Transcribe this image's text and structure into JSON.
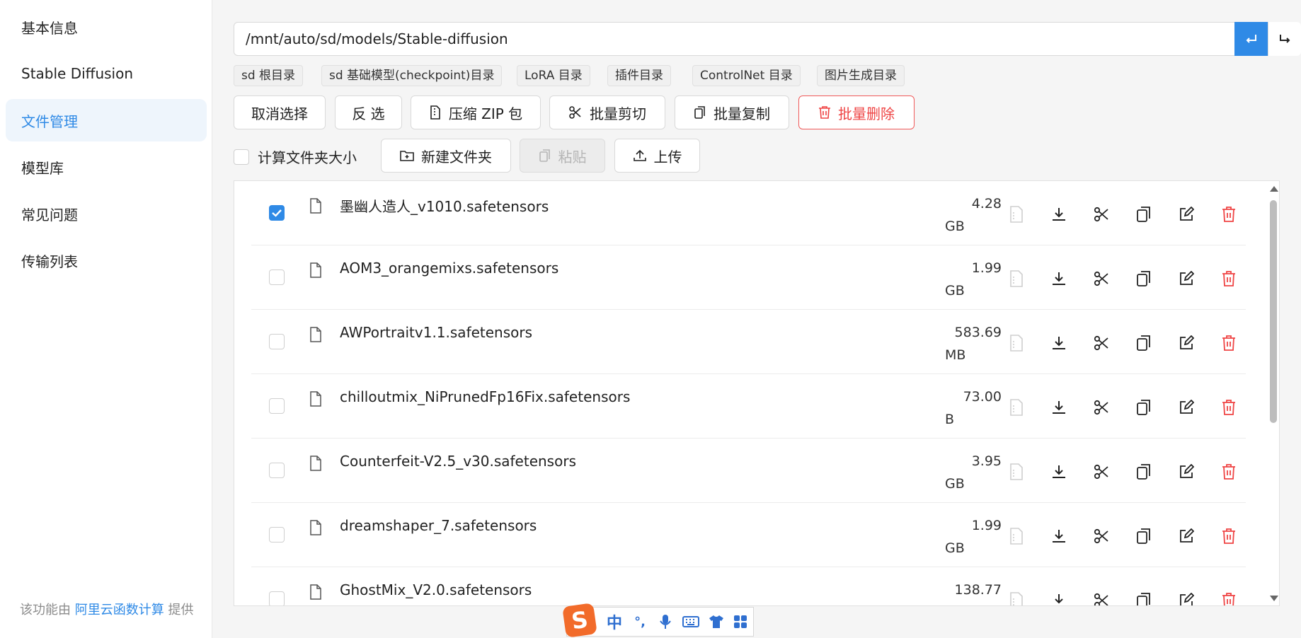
{
  "sidebar": {
    "items": [
      {
        "label": "基本信息",
        "active": false
      },
      {
        "label": "Stable Diffusion",
        "active": false
      },
      {
        "label": "文件管理",
        "active": true
      },
      {
        "label": "模型库",
        "active": false
      },
      {
        "label": "常见问题",
        "active": false
      },
      {
        "label": "传输列表",
        "active": false
      }
    ],
    "footer": {
      "prefix": "该功能由 ",
      "link": "阿里云函数计算",
      "suffix": " 提供"
    }
  },
  "path_bar": {
    "value": "/mnt/auto/sd/models/Stable-diffusion",
    "enter_icon": "enter-icon",
    "back_icon": "return-icon"
  },
  "shortcuts": [
    "sd 根目录",
    "sd 基础模型(checkpoint)目录",
    "LoRA 目录",
    "插件目录",
    "ControlNet 目录",
    "图片生成目录"
  ],
  "toolbar": {
    "deselect": "取消选择",
    "invert": "反 选",
    "zip": "压缩 ZIP 包",
    "batch_cut": "批量剪切",
    "batch_copy": "批量复制",
    "batch_delete": "批量删除",
    "calc_folder_size": "计算文件夹大小",
    "new_folder": "新建文件夹",
    "paste": "粘贴",
    "upload": "上传"
  },
  "files": [
    {
      "name": "墨幽人造人_v1010.safetensors",
      "size": "4.28",
      "unit": "GB",
      "checked": true
    },
    {
      "name": "AOM3_orangemixs.safetensors",
      "size": "1.99",
      "unit": "GB",
      "checked": false
    },
    {
      "name": "AWPortraitv1.1.safetensors",
      "size": "583.69",
      "unit": "MB",
      "checked": false
    },
    {
      "name": "chilloutmix_NiPrunedFp16Fix.safetensors",
      "size": "73.00",
      "unit": "B",
      "checked": false
    },
    {
      "name": "Counterfeit-V2.5_v30.safetensors",
      "size": "3.95",
      "unit": "GB",
      "checked": false
    },
    {
      "name": "dreamshaper_7.safetensors",
      "size": "1.99",
      "unit": "GB",
      "checked": false
    },
    {
      "name": "GhostMix_V2.0.safetensors",
      "size": "138.77",
      "unit": "",
      "checked": false
    }
  ],
  "row_actions": [
    "view-file-icon",
    "download-icon",
    "cut-icon",
    "copy-icon",
    "edit-icon",
    "delete-icon"
  ],
  "ime_toolbar": {
    "logo": "S",
    "mode": "中",
    "punct": "°,"
  },
  "colors": {
    "accent": "#2f8ae6",
    "danger": "#ef4444"
  }
}
